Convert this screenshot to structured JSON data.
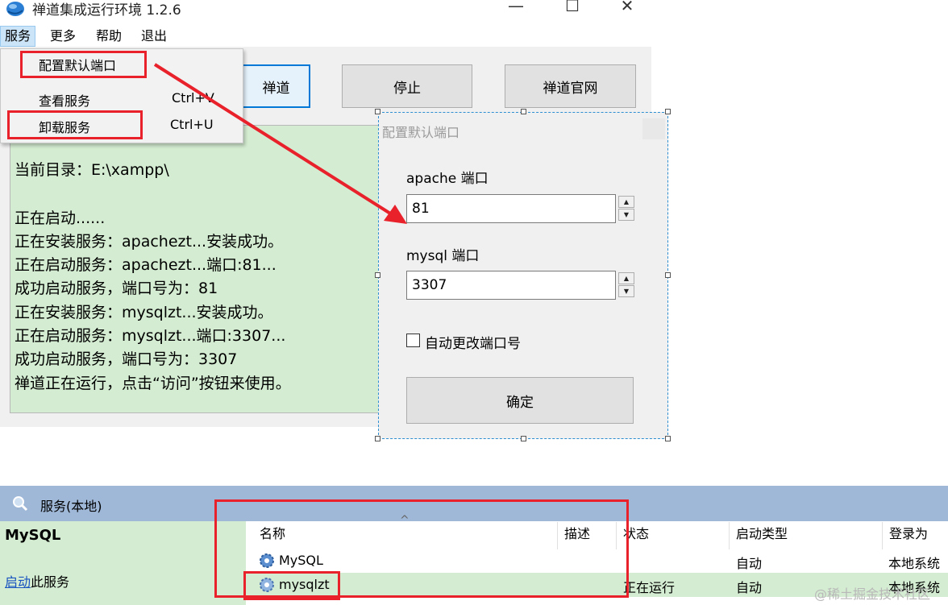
{
  "window": {
    "title": "禅道集成运行环境 1.2.6",
    "minimize_glyph": "—",
    "maximize_glyph": "☐",
    "close_glyph": "✕"
  },
  "menubar": [
    "服务",
    "更多",
    "帮助",
    "退出"
  ],
  "dropdown": {
    "items": [
      {
        "label": "配置默认端口",
        "shortcut": ""
      },
      {
        "label": "查看服务",
        "shortcut": "Ctrl+V"
      },
      {
        "label": "卸载服务",
        "shortcut": "Ctrl+U"
      }
    ]
  },
  "buttons": {
    "visit": "禅道",
    "stop": "停止",
    "official": "禅道官网"
  },
  "log": {
    "lines": [
      "当前目录：E:\\xampp\\",
      "正在启动......",
      "正在安装服务：apachezt...安装成功。",
      "正在启动服务：apachezt...端口:81...",
      "成功启动服务，端口号为：81",
      "正在安装服务：mysqlzt...安装成功。",
      "正在启动服务：mysqlzt...端口:3307...",
      "成功启动服务，端口号为：3307",
      "禅道正在运行，点击“访问”按钮来使用。"
    ]
  },
  "dialog": {
    "title": "配置默认端口",
    "apache_label": "apache 端口",
    "apache_value": "81",
    "mysql_label": "mysql 端口",
    "mysql_value": "3307",
    "auto_change_label": "自动更改端口号",
    "ok_label": "确定",
    "spin_up": "▲",
    "spin_down": "▼"
  },
  "services": {
    "header": "服务(本地)",
    "selected_service": "MySQL",
    "start_link": "启动",
    "start_suffix": "此服务",
    "sort_glyph": "^",
    "columns": [
      "名称",
      "描述",
      "状态",
      "启动类型",
      "登录为"
    ],
    "rows": [
      {
        "name": "MySQL",
        "desc": "",
        "status": "",
        "startup": "自动",
        "logon": "本地系统"
      },
      {
        "name": "mysqlzt",
        "desc": "",
        "status": "正在运行",
        "startup": "自动",
        "logon": "本地系统"
      }
    ]
  },
  "watermark": "@稀土掘金技术社区",
  "colors": {
    "highlight_red": "#e8212b",
    "log_bg": "#d4ecd1",
    "services_header": "#9fb8d8",
    "accent_blue": "#0078d7"
  }
}
